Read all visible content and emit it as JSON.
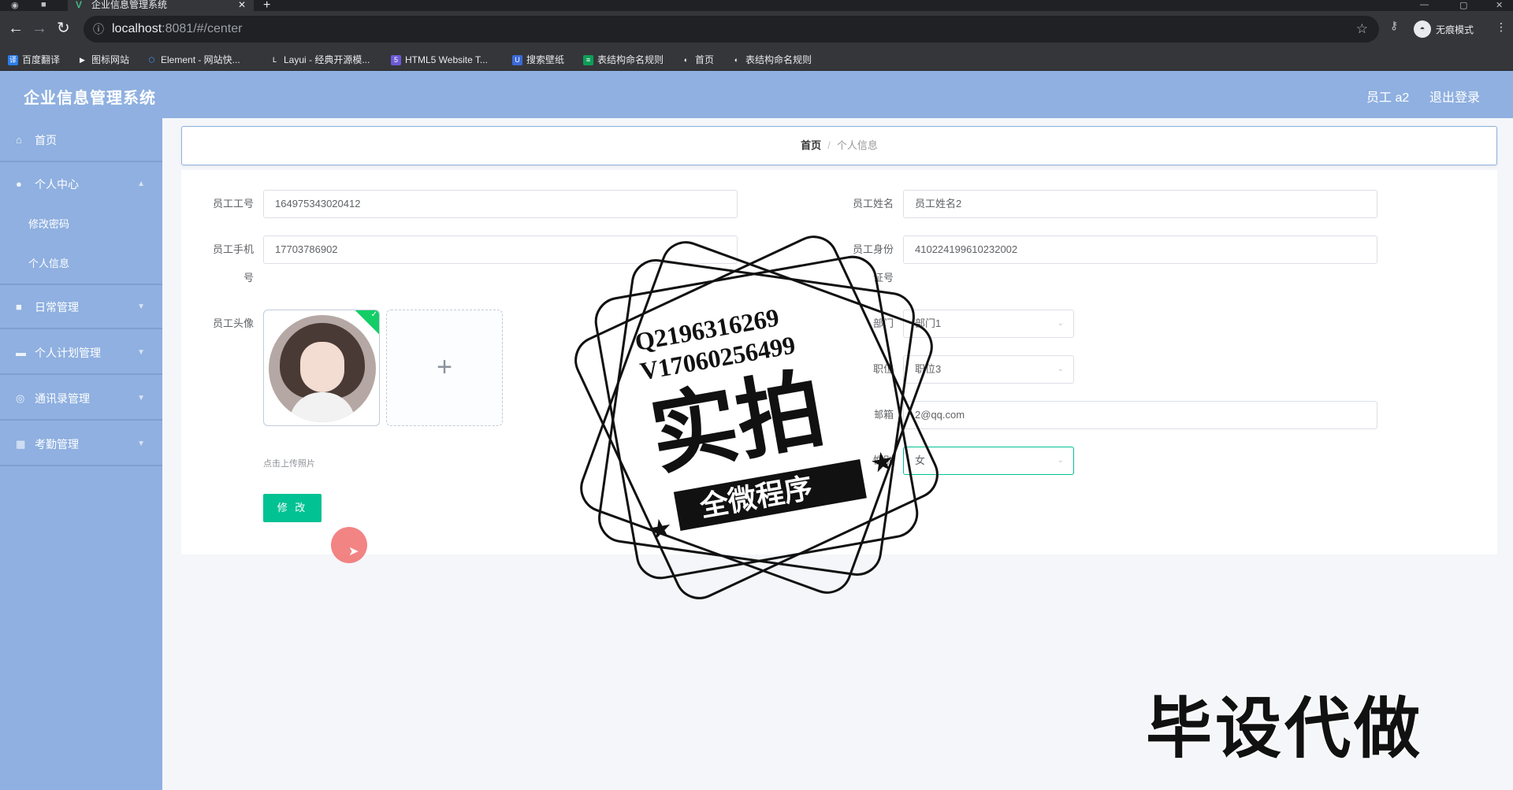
{
  "browser": {
    "tab_title": "企业信息管理系统",
    "tab_icon": "V",
    "close_glyph": "✕",
    "new_tab_glyph": "+",
    "url_host": "localhost",
    "url_path": ":8081/#/center",
    "incognito_label": "无痕模式",
    "bookmarks": [
      {
        "label": "百度翻译",
        "icon": "译",
        "color": "#2b7de9"
      },
      {
        "label": "图标网站",
        "icon": "▶",
        "color": "#35363a"
      },
      {
        "label": "Element - 网站快...",
        "icon": "⬡",
        "color": "#409eff"
      },
      {
        "label": "Layui - 经典开源模...",
        "icon": "L",
        "color": "#35363a"
      },
      {
        "label": "HTML5 Website T...",
        "icon": "5",
        "color": "#6b5bd6"
      },
      {
        "label": "搜索壁纸",
        "icon": "U",
        "color": "#3b6ad8"
      },
      {
        "label": "表结构命名规则",
        "icon": "≡",
        "color": "#0f9d58"
      },
      {
        "label": "首页",
        "icon": "◐",
        "color": "#35363a"
      },
      {
        "label": "表结构命名规则",
        "icon": "◐",
        "color": "#35363a"
      }
    ]
  },
  "header": {
    "title": "企业信息管理系统",
    "user": "员工 a2",
    "logout": "退出登录"
  },
  "sidebar": {
    "items": [
      {
        "label": "首页",
        "icon": "⌂"
      },
      {
        "label": "个人中心",
        "icon": "●"
      },
      {
        "label": "日常管理",
        "icon": "■"
      },
      {
        "label": "个人计划管理",
        "icon": "▬"
      },
      {
        "label": "通讯录管理",
        "icon": "◎"
      },
      {
        "label": "考勤管理",
        "icon": "▦"
      }
    ],
    "sub_items": [
      "修改密码",
      "个人信息"
    ]
  },
  "breadcrumb": {
    "home": "首页",
    "sep": "/",
    "current": "个人信息"
  },
  "form": {
    "employee_no_label": "员工工号",
    "employee_no": "164975343020412",
    "employee_name_label": "员工姓名",
    "employee_name": "员工姓名2",
    "phone_label_1": "员工手机",
    "phone_label_2": "号",
    "phone": "17703786902",
    "id_label_1": "员工身份",
    "id_label_2": "证号",
    "id_no": "410224199610232002",
    "avatar_label": "员工头像",
    "upload_plus": "+",
    "upload_tip": "点击上传照片",
    "dept_label": "部门",
    "dept": "部门1",
    "position_label": "职位",
    "position": "职位3",
    "email_label": "邮箱",
    "email": "2@qq.com",
    "gender_label": "性别",
    "gender": "女",
    "submit": "修 改"
  },
  "watermark": {
    "qq": "Q2196316269",
    "v": "V17060256499",
    "big": "实拍",
    "ribbon": "全微程序",
    "bottom": "毕设代做"
  }
}
